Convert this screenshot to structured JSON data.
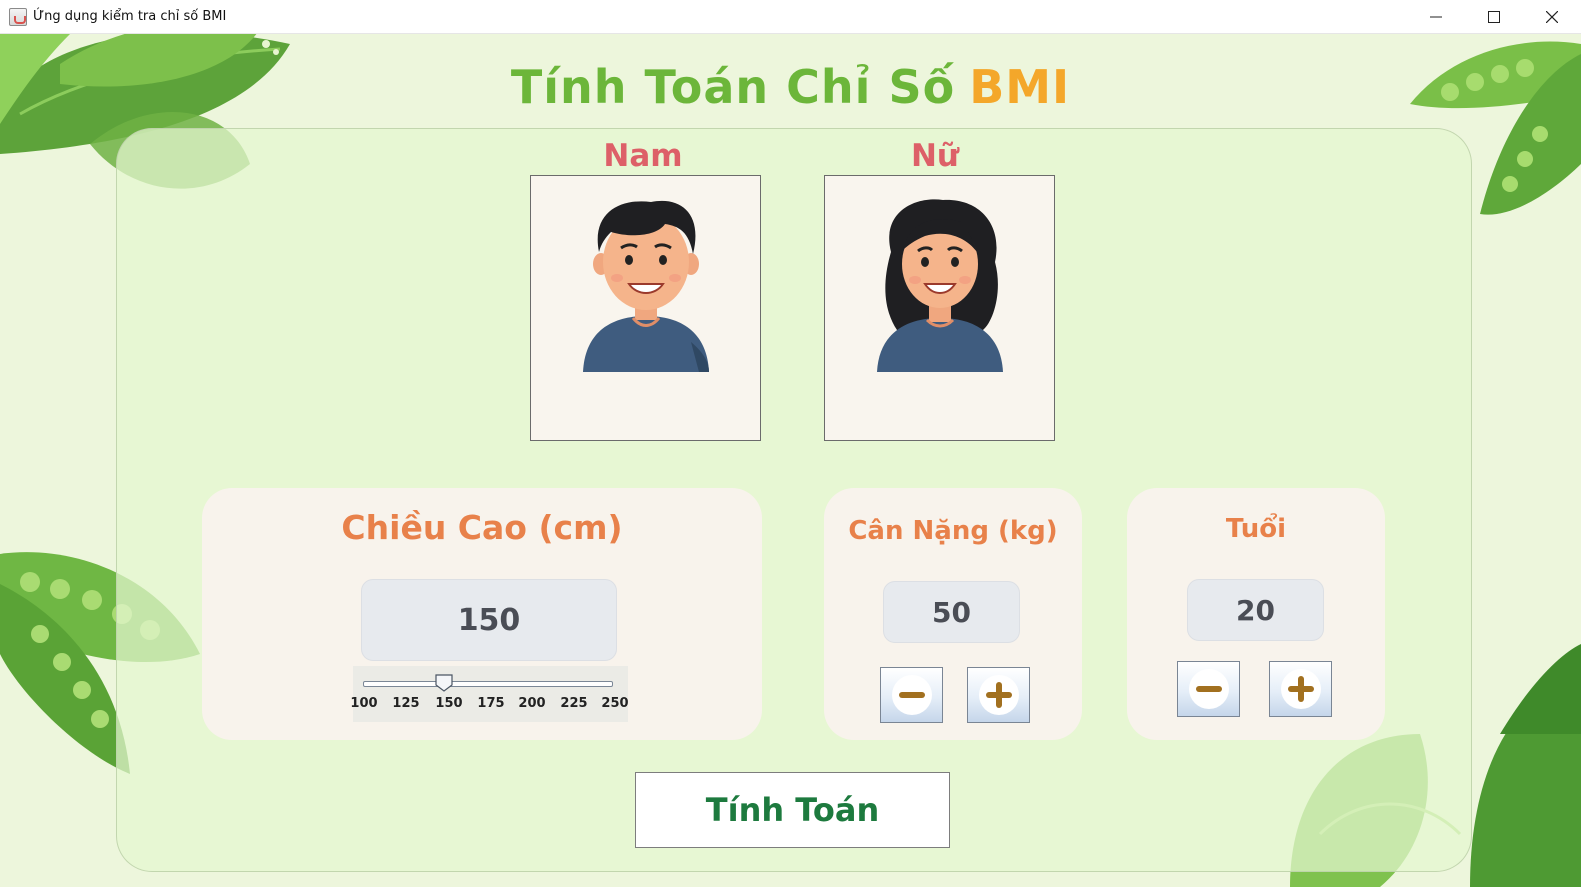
{
  "window": {
    "title": "Ứng dụng kiểm tra chỉ số BMI",
    "controls": {
      "minimize": "—",
      "maximize": "☐",
      "close": "✕"
    }
  },
  "header": {
    "title_part1": "Tính Toán Chỉ Số",
    "title_part2": "BMI"
  },
  "gender": {
    "male_label": "Nam",
    "female_label": "Nữ"
  },
  "height_card": {
    "title": "Chiều Cao (cm)",
    "value": "150",
    "slider": {
      "min": 100,
      "max": 250,
      "value": 150,
      "ticks": [
        "100",
        "125",
        "150",
        "175",
        "200",
        "225",
        "250"
      ]
    }
  },
  "weight_card": {
    "title": "Cân Nặng (kg)",
    "value": "50"
  },
  "age_card": {
    "title": "Tuổi",
    "value": "20"
  },
  "actions": {
    "calculate_label": "Tính Toán"
  },
  "colors": {
    "title_green": "#6cb63a",
    "title_orange": "#f4a72a",
    "gender_label": "#dd6068",
    "card_title": "#e8814a",
    "calc_text": "#1d7a3e",
    "stepper_icon": "#a2701f"
  }
}
